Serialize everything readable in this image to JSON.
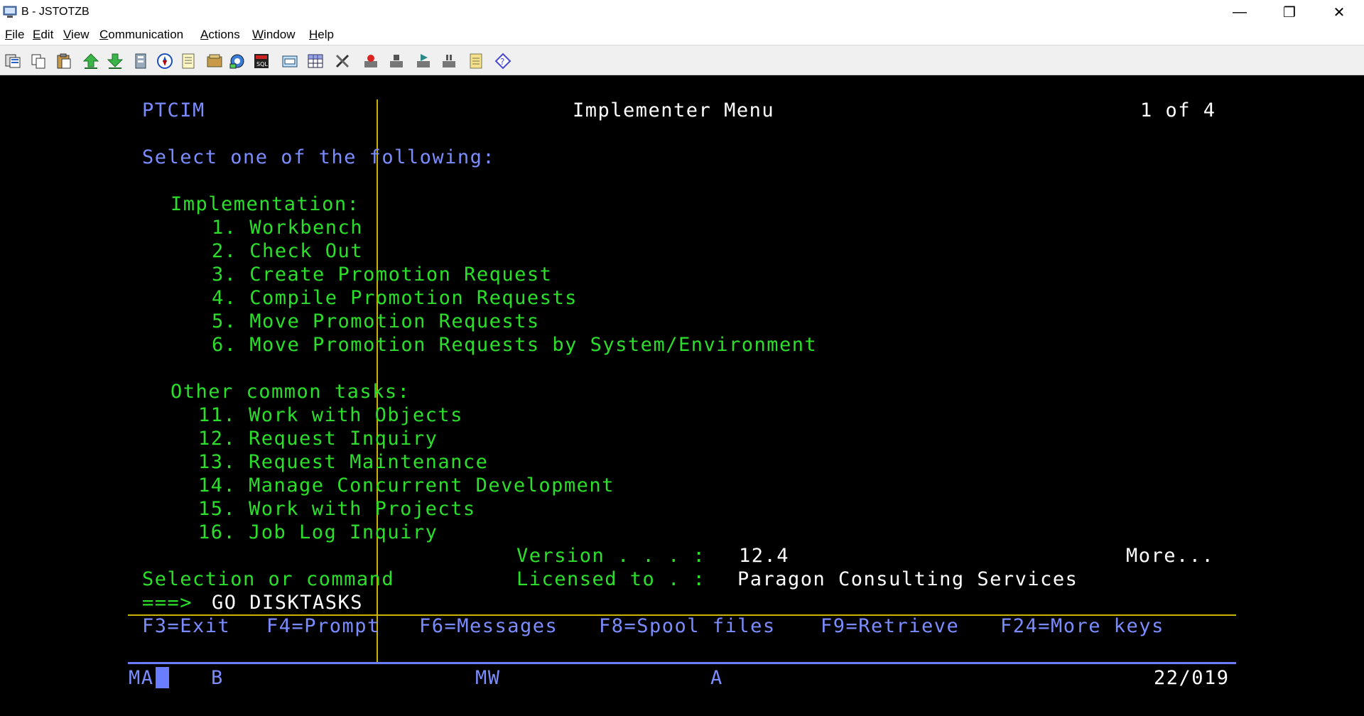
{
  "window": {
    "title": "B - JSTOTZB",
    "minimize": "—",
    "restore": "❐",
    "close": "✕"
  },
  "menu": [
    "File",
    "Edit",
    "View",
    "Communication",
    "Actions",
    "Window",
    "Help"
  ],
  "toolbar_icons": [
    "copy-screen-icon",
    "copy-icon",
    "paste-icon",
    "send-file-icon",
    "receive-file-icon",
    "print-icon",
    "navigate-icon",
    "notes-icon",
    "macro-icon",
    "settings-icon",
    "sql-icon",
    "keyboard-map-icon",
    "grid-icon",
    "tools-icon",
    "record-macro-icon",
    "stop-macro-icon",
    "play-macro-icon",
    "pause-macro-icon",
    "notepad-icon",
    "help-icon"
  ],
  "screen": {
    "system_name": "PTCIM",
    "title": "Implementer Menu",
    "page": "1 of 4",
    "prompt": "Select one of the following:",
    "section1_heading": "Implementation:",
    "section1_items": [
      "1. Workbench",
      "2. Check Out",
      "3. Create Promotion Request",
      "4. Compile Promotion Requests",
      "5. Move Promotion Requests",
      "6. Move Promotion Requests by System/Environment"
    ],
    "section2_heading": "Other common tasks:",
    "section2_items": [
      "11. Work with Objects",
      "12. Request Inquiry",
      "13. Request Maintenance",
      "14. Manage Concurrent Development",
      "15. Work with Projects",
      "16. Job Log Inquiry"
    ],
    "version_label": "Version . . . :",
    "version_value": "12.4",
    "more": "More...",
    "selection_label": "Selection or command",
    "licensed_label": "Licensed to . :",
    "licensed_value": "Paragon Consulting Services",
    "command_prompt": "===>",
    "command_value": "GO DISKTASKS",
    "function_keys": [
      "F3=Exit",
      "F4=Prompt",
      "F6=Messages",
      "F8=Spool files",
      "F9=Retrieve",
      "F24=More keys"
    ]
  },
  "status_bar": {
    "session": "MA",
    "session_letter": "B",
    "mode": "MW",
    "indicator": "A",
    "cursor_position": "22/019"
  }
}
